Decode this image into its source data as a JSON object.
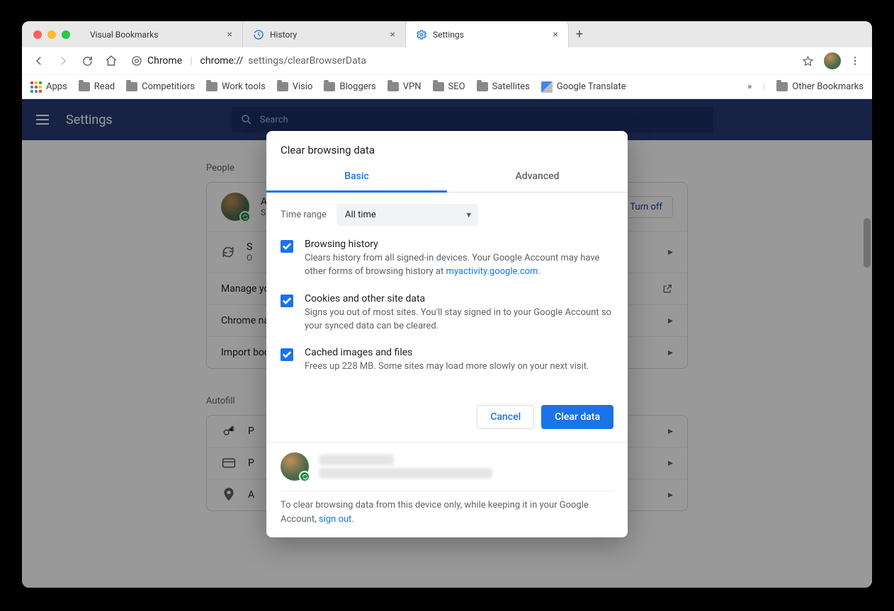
{
  "tabs": [
    {
      "label": "Visual Bookmarks"
    },
    {
      "label": "History"
    },
    {
      "label": "Settings"
    }
  ],
  "addr": {
    "prefix": "Chrome",
    "url_host": "chrome://",
    "url_path": "settings/clearBrowserData"
  },
  "bookmarks": {
    "apps": "Apps",
    "items": [
      "Read",
      "Competitiors",
      "Work tools",
      "Visio",
      "Bloggers",
      "VPN",
      "SEO",
      "Satellites"
    ],
    "translate": "Google Translate",
    "overflow": "»",
    "other": "Other Bookmarks"
  },
  "settings": {
    "header_title": "Settings",
    "search_placeholder": "Search",
    "sections": {
      "people": "People",
      "autofill": "Autofill"
    },
    "rows": {
      "account_initial": "A",
      "account_sub": "S",
      "turn_off": "Turn off",
      "sync_label": "S",
      "sync_sub": "O",
      "manage": "Manage yo",
      "chrome_name": "Chrome na",
      "import": "Import boo",
      "passwords": "P",
      "payment": "P",
      "addresses": "A"
    }
  },
  "modal": {
    "title": "Clear browsing data",
    "tab_basic": "Basic",
    "tab_advanced": "Advanced",
    "time_label": "Time range",
    "time_value": "All time",
    "items": {
      "history": {
        "title": "Browsing history",
        "desc_1": "Clears history from all signed-in devices. Your Google Account may have other forms of browsing history at ",
        "link": "myactivity.google.com",
        "desc_2": "."
      },
      "cookies": {
        "title": "Cookies and other site data",
        "desc": "Signs you out of most sites. You'll stay signed in to your Google Account so your synced data can be cleared."
      },
      "cache": {
        "title": "Cached images and files",
        "desc": "Frees up 228 MB. Some sites may load more slowly on your next visit."
      }
    },
    "cancel": "Cancel",
    "clear": "Clear data",
    "footer_note_1": "To clear browsing data from this device only, while keeping it in your Google Account, ",
    "footer_link": "sign out",
    "footer_note_2": "."
  }
}
